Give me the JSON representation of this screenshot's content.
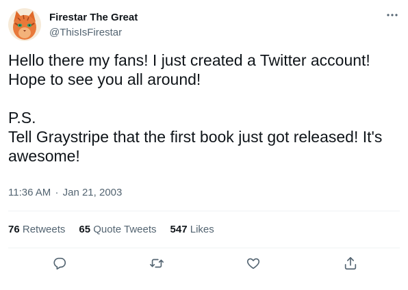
{
  "author": {
    "display_name": "Firestar The Great",
    "handle": "@ThisIsFirestar",
    "avatar_icon": "orange-cat-avatar"
  },
  "tweet": {
    "lines": [
      "Hello there my fans! I just created a Twitter account!",
      "Hope to see you all around!",
      "",
      "P.S.",
      "Tell Graystripe that the first book just got released! It's",
      "awesome!"
    ]
  },
  "meta": {
    "time": "11:36 AM",
    "separator": "·",
    "date": "Jan 21, 2003"
  },
  "stats": {
    "retweets_count": "76",
    "retweets_label": "Retweets",
    "quotes_count": "65",
    "quotes_label": "Quote Tweets",
    "likes_count": "547",
    "likes_label": "Likes"
  },
  "actions": [
    "reply-icon",
    "retweet-icon",
    "like-icon",
    "share-icon"
  ],
  "colors": {
    "text": "#0f1419",
    "secondary": "#536471",
    "divider": "#eff3f4",
    "avatar_orange": "#e8793a"
  }
}
